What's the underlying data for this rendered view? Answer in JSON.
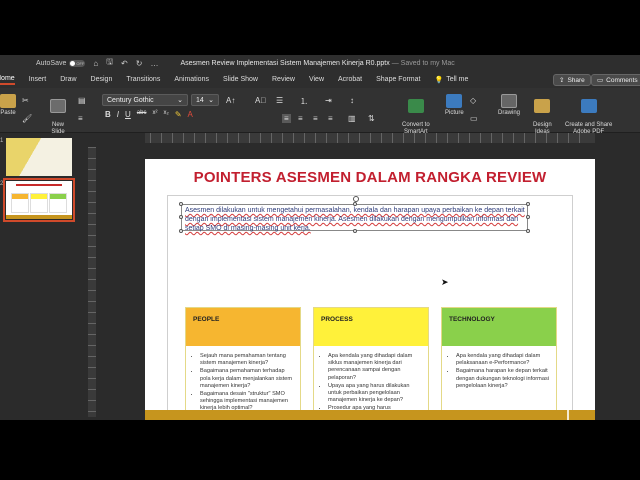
{
  "titlebar": {
    "autosave_label": "AutoSave",
    "autosave_state": "OFF",
    "doc_title": "Asesmen Review Implementasi Sistem Manajemen Kinerja R0.pptx",
    "saved_status": "— Saved to my Mac"
  },
  "ribbon_tabs": [
    "Home",
    "Insert",
    "Draw",
    "Design",
    "Transitions",
    "Animations",
    "Slide Show",
    "Review",
    "View",
    "Acrobat",
    "Shape Format"
  ],
  "tell_me": "Tell me",
  "share_label": "Share",
  "comments_label": "Comments",
  "ribbon": {
    "paste": "Paste",
    "new_slide": "New\nSlide",
    "font_name": "Century Gothic",
    "font_size": "14",
    "convert_smartart": "Convert to\nSmartArt",
    "picture": "Picture",
    "drawing": "Drawing",
    "design_ideas": "Design\nIdeas",
    "create_share_pdf": "Create and Share\nAdobe PDF",
    "format_buttons": [
      "B",
      "I",
      "U",
      "abc",
      "x²",
      "x₂"
    ]
  },
  "thumbnails": [
    {
      "number": "1",
      "selected": false
    },
    {
      "number": "2",
      "selected": true
    }
  ],
  "slide": {
    "title": "POINTERS ASESMEN DALAM RANGKA REVIEW",
    "body": "Asesmen dilakukan untuk mengetahui permasalahan, kendala dan harapan upaya perbaikan ke depan terkait dengan implementasi sistem manajemen kinerja. Asesmen dilakukan dengan mengumpulkan informasi dari setiap SMO di masing-masing unit kerja.",
    "columns": [
      {
        "heading": "PEOPLE",
        "color": "#f6b630",
        "items": [
          "Sejauh mana pemahaman tentang sistem manajemen kinerja?",
          "Bagaimana pemahaman terhadap pola kerja dalam menjalankan sistem manajemen kinerja?",
          "Bagaimana desain \"struktur\" SMO sehingga implementasi manajemen kinerja lebih optimal?"
        ]
      },
      {
        "heading": "PROCESS",
        "color": "#fff13a",
        "items": [
          "Apa kendala yang dihadapi dalam siklus manajemen kinerja dari perencanaan sampai dengan pelaporan?",
          "Upaya apa yang harus dilakukan untuk perbaikan pengelolaan manajemen kinerja ke depan?",
          "Prosedur apa yang harus didokumentasikan sehingga pengelolaan sistem manajemen kinerja lebih optimal?"
        ]
      },
      {
        "heading": "TECHNOLOGY",
        "color": "#8ad04b",
        "items": [
          "Apa kendala yang dihadapi dalam pelaksanaan e-Performance?",
          "Bagaimana harapan ke depan terkait dengan dukungan teknologi informasi pengelolaan kinerja?"
        ]
      }
    ]
  },
  "colors": {
    "title_red": "#c21f2f",
    "body_blue": "#2d3b7a",
    "bottom_bar": "#c6951e",
    "accent_tab": "#d04a2b"
  }
}
